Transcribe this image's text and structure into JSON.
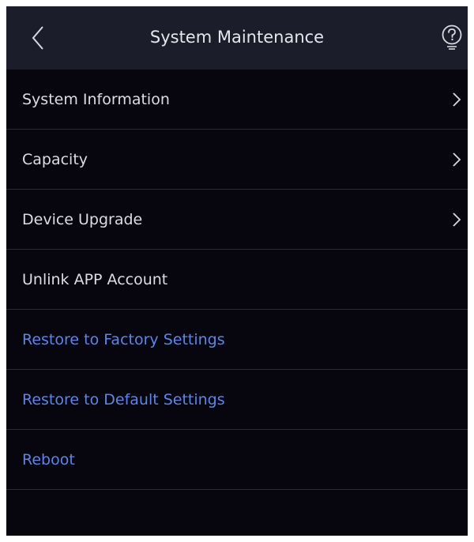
{
  "header": {
    "title": "System Maintenance",
    "back_icon": "chevron-left-icon",
    "help_icon": "question-circle-icon"
  },
  "menu": [
    {
      "id": "system-information",
      "label": "System Information",
      "has_chevron": true,
      "accent": false
    },
    {
      "id": "capacity",
      "label": "Capacity",
      "has_chevron": true,
      "accent": false
    },
    {
      "id": "device-upgrade",
      "label": "Device Upgrade",
      "has_chevron": true,
      "accent": false
    },
    {
      "id": "unlink-app-account",
      "label": "Unlink APP Account",
      "has_chevron": false,
      "accent": false
    },
    {
      "id": "restore-factory",
      "label": "Restore to Factory Settings",
      "has_chevron": false,
      "accent": true
    },
    {
      "id": "restore-default",
      "label": "Restore to Default Settings",
      "has_chevron": false,
      "accent": true
    },
    {
      "id": "reboot",
      "label": "Reboot",
      "has_chevron": false,
      "accent": true
    }
  ],
  "colors": {
    "background": "#07060e",
    "header_background": "#1c1d2b",
    "text": "#dcdce2",
    "accent_text": "#5b86e6",
    "divider": "#2a2a36"
  }
}
